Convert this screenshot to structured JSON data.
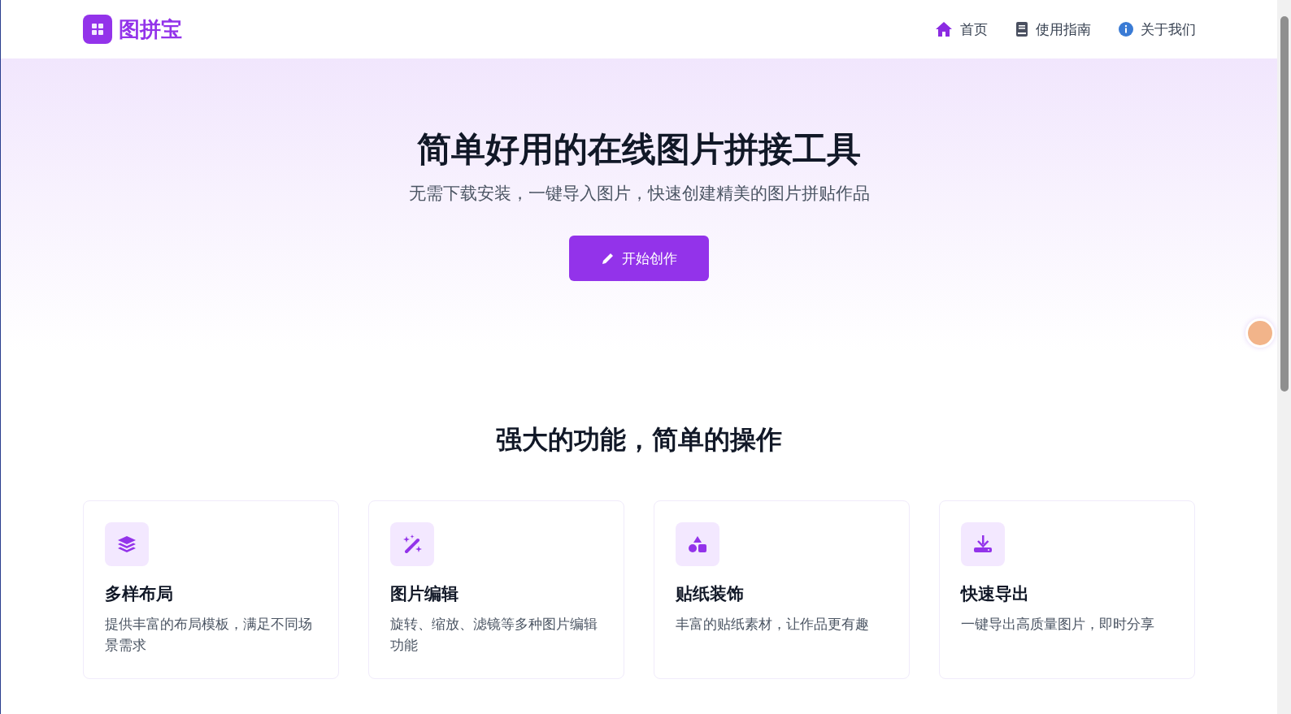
{
  "brand": {
    "name": "图拼宝"
  },
  "nav": [
    {
      "label": "首页"
    },
    {
      "label": "使用指南"
    },
    {
      "label": "关于我们"
    }
  ],
  "hero": {
    "title": "简单好用的在线图片拼接工具",
    "subtitle": "无需下载安装，一键导入图片，快速创建精美的图片拼贴作品",
    "button": "开始创作"
  },
  "features": {
    "title": "强大的功能，简单的操作",
    "items": [
      {
        "title": "多样布局",
        "text": "提供丰富的布局模板，满足不同场景需求"
      },
      {
        "title": "图片编辑",
        "text": "旋转、缩放、滤镜等多种图片编辑功能"
      },
      {
        "title": "贴纸装饰",
        "text": "丰富的贴纸素材，让作品更有趣"
      },
      {
        "title": "快速导出",
        "text": "一键导出高质量图片，即时分享"
      }
    ]
  }
}
